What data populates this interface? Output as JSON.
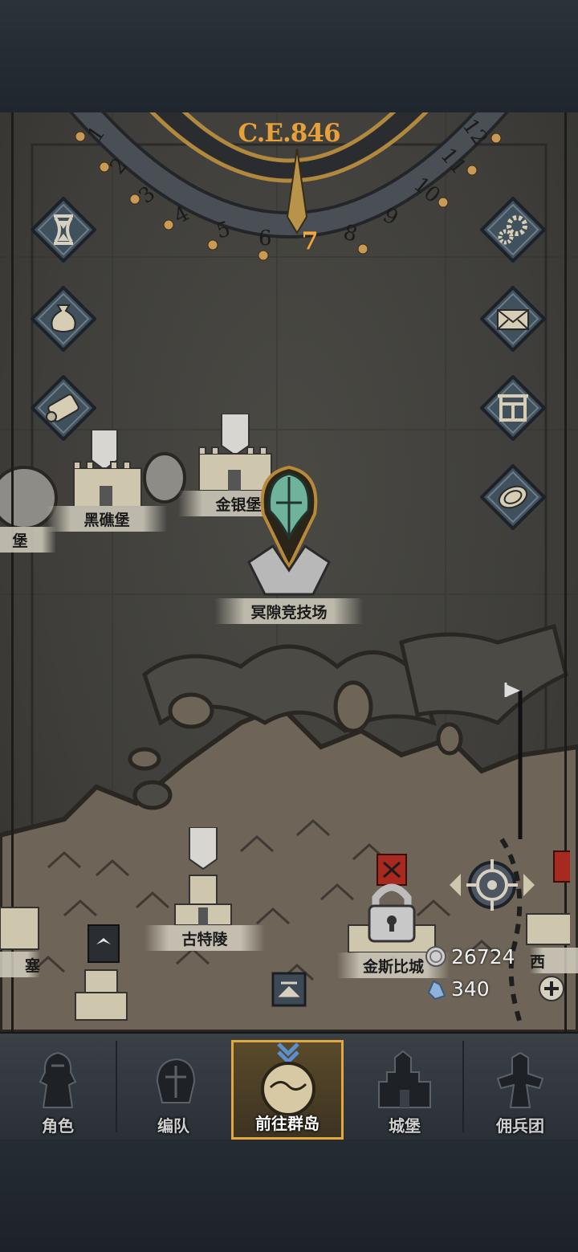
{
  "calendar": {
    "year": "C.E.846",
    "current_month": "7",
    "ring_numbers": [
      "1",
      "2",
      "3",
      "4",
      "5",
      "6",
      "8",
      "9",
      "10",
      "11",
      "12"
    ]
  },
  "left_buttons": [
    {
      "name": "hourglass-icon"
    },
    {
      "name": "money-bag-icon"
    },
    {
      "name": "scroll-icon"
    }
  ],
  "right_buttons": [
    {
      "name": "gear-icon"
    },
    {
      "name": "mail-icon"
    },
    {
      "name": "board-icon"
    },
    {
      "name": "coin-icon"
    }
  ],
  "locations": {
    "partial_left": "堡",
    "heijiaobao": "黑礁堡",
    "jinyinbao": "金银堡",
    "arena": "冥隙竞技场",
    "gutiling": "古特陵",
    "jinsibicheng": "金斯比城",
    "partial_right": "西",
    "partial_left_lower": "塞"
  },
  "resources": {
    "silver": "26724",
    "crystal": "340"
  },
  "nav": {
    "tabs": [
      {
        "label": "角色"
      },
      {
        "label": "编队"
      },
      {
        "label": "前往群岛"
      },
      {
        "label": "城堡"
      },
      {
        "label": "佣兵团"
      }
    ],
    "active_index": 2
  },
  "colors": {
    "accent_gold": "#e2a83e",
    "year_text": "#e8a13a",
    "banner_red": "#a8291f"
  }
}
